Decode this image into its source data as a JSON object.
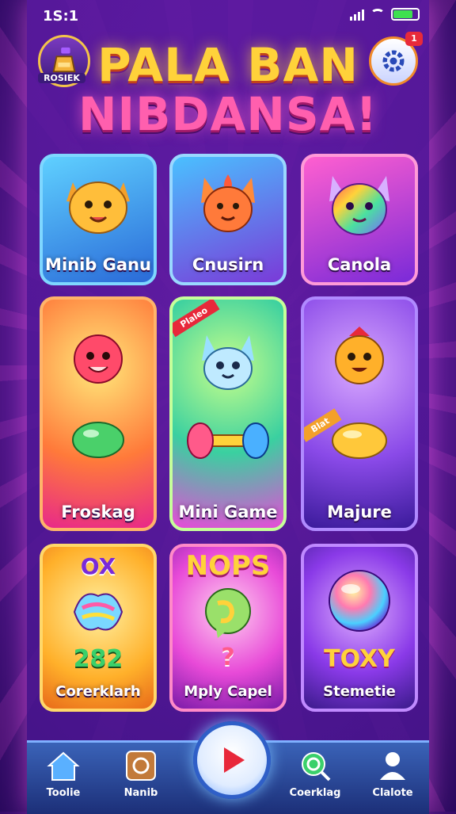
{
  "status_bar": {
    "time": "1S:1"
  },
  "header": {
    "profile_label": "ROSIEK",
    "title_line1": "PALA BAN",
    "title_line2": "NIBDANSA!",
    "notification_badge": "1"
  },
  "cards": [
    {
      "label": "Minib Ganu",
      "icon": "cat-icon"
    },
    {
      "label": "Cnusirn",
      "icon": "fox-icon"
    },
    {
      "label": "Canola",
      "icon": "rainbow-cat-icon"
    },
    {
      "label": "Froskag",
      "icon": "pink-blob-icon"
    },
    {
      "label": "Mini Game",
      "icon": "bunny-icon",
      "ribbon": "Plaleo"
    },
    {
      "label": "Majure",
      "icon": "orange-blob-icon",
      "ribbon": "Blat"
    },
    {
      "label": "Corerklarh",
      "icon": "candy-icon",
      "top_text": "OX",
      "mid_text": "282"
    },
    {
      "label": "Mply Capel",
      "icon": "leaf-bubble-icon",
      "top_text": "NOPS",
      "mid_text": "?"
    },
    {
      "label": "Stemetie",
      "icon": "orb-icon",
      "mid_text": "TOXY"
    }
  ],
  "nav": [
    {
      "label": "Toolie",
      "icon": "home-icon"
    },
    {
      "label": "Nanib",
      "icon": "puzzle-icon"
    },
    {
      "label": "Coerklag",
      "icon": "search-icon"
    },
    {
      "label": "Clalote",
      "icon": "user-icon"
    }
  ],
  "colors": {
    "accent_yellow": "#ffd23a",
    "accent_pink": "#ff5fae",
    "nav_blue": "#2f5fc8",
    "play_red": "#e8283a"
  }
}
